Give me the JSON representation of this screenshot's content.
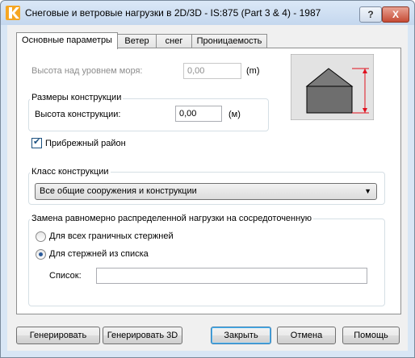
{
  "window": {
    "title": "Снеговые и ветровые нагрузки в 2D/3D - IS:875 (Part 3 & 4) - 1987",
    "help_label": "?",
    "close_label": "X"
  },
  "tabs": [
    {
      "label": "Основные параметры",
      "active": true
    },
    {
      "label": "Ветер",
      "active": false
    },
    {
      "label": "снег",
      "active": false
    },
    {
      "label": "Проницаемость",
      "active": false
    }
  ],
  "altitude": {
    "label": "Высота над уровнем моря:",
    "value": "0,00",
    "unit": "(m)"
  },
  "dimensions": {
    "group_title": "Размеры конструкции",
    "height_label": "Высота конструкции:",
    "height_value": "0,00",
    "height_unit": "(м)"
  },
  "coastal": {
    "label": "Прибрежный район",
    "checked": true,
    "check_mark": "✔"
  },
  "structure_class": {
    "group_title": "Класс конструкции",
    "selected": "Все общие сооружения и конструкции",
    "arrow": "▼"
  },
  "load_replacement": {
    "group_title": "Замена равномерно распределенной нагрузки на сосредоточенную",
    "option_all": "Для всех граничных стержней",
    "option_list": "Для стержней из списка",
    "selected": "option_list",
    "list_label": "Список:",
    "list_value": ""
  },
  "buttons": {
    "generate": "Генерировать",
    "generate3d": "Генерировать 3D",
    "close": "Закрыть",
    "cancel": "Отмена",
    "help": "Помощь"
  },
  "colors": {
    "accent": "#2a5a9a",
    "dimension_line": "#e0101e",
    "building": "#6e6e6e"
  }
}
